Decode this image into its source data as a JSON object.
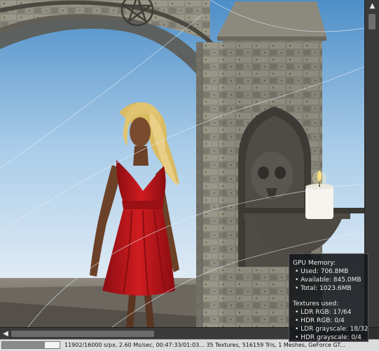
{
  "viewport": {
    "scene": "rendered-3d-scene"
  },
  "status_bar": {
    "progress": 0.74,
    "text": "11902/16000 s/px, 2.60 Ms/sec, 00:47:33/01:03... 35 Textures, 516159 Tris, 1 Meshes, GeForce GT..."
  },
  "gpu_panel": {
    "title": "GPU Memory:",
    "memory": [
      "Used: 706.8MB",
      "Available: 845.0MB",
      "Total: 1023.6MB"
    ],
    "textures_title": "Textures used:",
    "textures": [
      "LDR RGB: 17/64",
      "HDR RGB: 0/4",
      "LDR grayscale: 18/32",
      "HDR grayscale: 0/4"
    ]
  },
  "scrollbars": {
    "vertical_position": 0.05,
    "horizontal_position": 0.0
  },
  "colors": {
    "sky_top": "#4d8ec8",
    "sky_bottom": "#f2f6fa",
    "stone": "#807d72",
    "dress": "#c4161b",
    "hair": "#e0c471",
    "panel_bg": "#16181c",
    "statusbar_bg": "#dcdcdc"
  },
  "icons": {
    "scroll_up": "triangle-up-icon",
    "scroll_left": "triangle-left-icon",
    "bullet": "bullet-icon"
  }
}
